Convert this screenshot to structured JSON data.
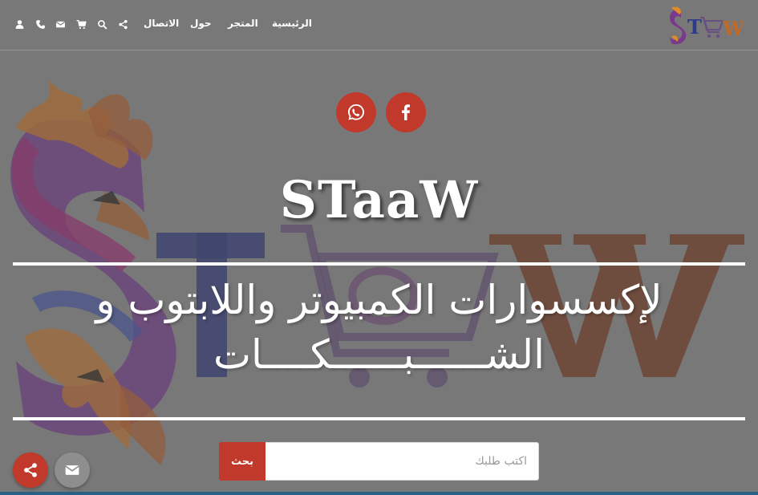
{
  "brand": {
    "logo_text": "STaaW"
  },
  "nav": {
    "items": [
      {
        "label": "الرئيسية"
      },
      {
        "label": "المتجر"
      },
      {
        "label": "حول"
      },
      {
        "label": "الاتصال"
      }
    ],
    "icons": [
      "share-icon",
      "search-icon",
      "cart-icon",
      "mail-icon",
      "phone-icon",
      "user-icon"
    ]
  },
  "social": [
    "facebook-icon",
    "whatsapp-icon"
  ],
  "hero": {
    "title": "STaaW",
    "tagline_line1": "لإكسسوارات الكمبيوتر واللابتوب و",
    "tagline_line2": "الشــــــبــــــكــــات"
  },
  "search": {
    "placeholder": "اكتب طلبك",
    "button_label": "بحث"
  },
  "floating": [
    "share-icon",
    "mail-icon"
  ],
  "colors": {
    "accent": "#c0392b",
    "overlay": "#7c7c7c",
    "footer_line": "#2a5f86"
  }
}
